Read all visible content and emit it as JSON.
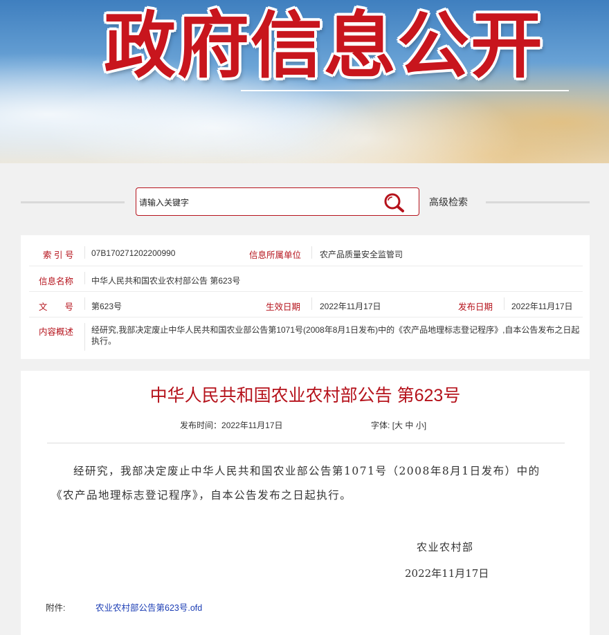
{
  "banner": {
    "title": "政府信息公开"
  },
  "search": {
    "placeholder": "请输入关键字",
    "advanced_label": "高级检索"
  },
  "meta": {
    "index_label": "索 引 号",
    "index_value": "07B170271202200990",
    "org_label": "信息所属单位",
    "org_value": "农产品质量安全监管司",
    "name_label": "信息名称",
    "name_value": "中华人民共和国农业农村部公告 第623号",
    "docno_label": "文　　号",
    "docno_value": "第623号",
    "effective_label": "生效日期",
    "effective_value": "2022年11月17日",
    "publish_label": "发布日期",
    "publish_value": "2022年11月17日",
    "summary_label": "内容概述",
    "summary_value": "经研究,我部决定废止中华人民共和国农业部公告第1071号(2008年8月1日发布)中的《农产品地理标志登记程序》,自本公告发布之日起执行。"
  },
  "article": {
    "title": "中华人民共和国农业农村部公告 第623号",
    "publish_time_label": "发布时间：",
    "publish_time_value": "2022年11月17日",
    "font_label": "字体:",
    "font_open": "[",
    "font_large": "大",
    "font_medium": "中",
    "font_small": "小",
    "font_close": "]",
    "body": "经研究，我部决定废止中华人民共和国农业部公告第1071号（2008年8月1日发布）中的《农产品地理标志登记程序》，自本公告发布之日起执行。",
    "signature": "农业农村部",
    "sign_date": "2022年11月17日",
    "attachment_label": "附件:",
    "attachment_link": "农业农村部公告第623号.ofd"
  },
  "colors": {
    "accent": "#b5121b",
    "link": "#1b3db4",
    "page_bg": "#f1f1f1"
  },
  "icons": {
    "search": "search-icon"
  }
}
